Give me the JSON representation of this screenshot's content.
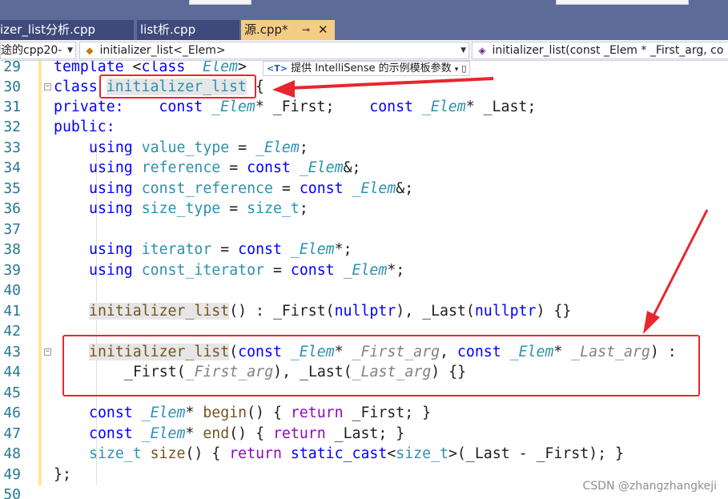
{
  "tabs": [
    {
      "label": "izer_list分析.cpp",
      "active": false
    },
    {
      "label": "list析.cpp",
      "active": false
    },
    {
      "label": "源.cpp*",
      "active": true,
      "pin": "⊸",
      "close": "✕"
    }
  ],
  "navbar": {
    "project": "途的cpp20-",
    "scope": "initializer_list<_Elem>",
    "member": "initializer_list(const _Elem * _First_arg, co"
  },
  "intellisense_hint": {
    "badge": "<T>",
    "text": "提供 IntelliSense 的示例模板参数"
  },
  "line_numbers": [
    "29",
    "30",
    "31",
    "32",
    "33",
    "34",
    "35",
    "36",
    "37",
    "38",
    "39",
    "40",
    "41",
    "42",
    "43",
    "44",
    "45",
    "46",
    "47",
    "48",
    "49",
    "50"
  ],
  "code": {
    "l29": {
      "kw": "template",
      "p1": " <",
      "kw2": "class",
      "sp": " ",
      "tp": "_Elem",
      "p2": ">"
    },
    "l30": {
      "kw": "class",
      "sp": " ",
      "name": "initializer_list",
      "p": " {"
    },
    "l31": {
      "kw": "private:",
      "sp1": "    ",
      "kw2": "const",
      "sp2": " ",
      "tp": "_Elem",
      "p1": "* _First;",
      "sp3": "    ",
      "kw3": "const",
      "sp4": " ",
      "tp2": "_Elem",
      "p2": "* _Last;"
    },
    "l32": {
      "kw": "public:"
    },
    "l33": {
      "kw": "using",
      "sp": " ",
      "ty": "value_type",
      "p1": " = ",
      "tp": "_Elem",
      "p2": ";"
    },
    "l34": {
      "kw": "using",
      "sp": " ",
      "ty": "reference",
      "p1": " = ",
      "kw2": "const",
      "sp2": " ",
      "tp": "_Elem",
      "p2": "&;"
    },
    "l35": {
      "kw": "using",
      "sp": " ",
      "ty": "const_reference",
      "p1": " = ",
      "kw2": "const",
      "sp2": " ",
      "tp": "_Elem",
      "p2": "&;"
    },
    "l36": {
      "kw": "using",
      "sp": " ",
      "ty": "size_type",
      "p1": " = ",
      "ty2": "size_t",
      "p2": ";"
    },
    "l38": {
      "kw": "using",
      "sp": " ",
      "ty": "iterator",
      "p1": " = ",
      "kw2": "const",
      "sp2": " ",
      "tp": "_Elem",
      "p2": "*;"
    },
    "l39": {
      "kw": "using",
      "sp": " ",
      "ty": "const_iterator",
      "p1": " = ",
      "kw2": "const",
      "sp2": " ",
      "tp": "_Elem",
      "p2": "*;"
    },
    "l41": {
      "fn": "initializer_list",
      "p1": "() : _First(",
      "kw": "nullptr",
      "p2": "), _Last(",
      "kw2": "nullptr",
      "p3": ") {}"
    },
    "l43": {
      "fn": "initializer_list",
      "p1": "(",
      "kw": "const",
      "sp": " ",
      "tp": "_Elem",
      "p2": "* ",
      "pr": "_First_arg",
      "p3": ", ",
      "kw2": "const",
      "sp2": " ",
      "tp2": "_Elem",
      "p4": "* ",
      "pr2": "_Last_arg",
      "p5": ") :"
    },
    "l44": {
      "p1": "_First(",
      "pr": "_First_arg",
      "p2": "), _Last(",
      "pr2": "_Last_arg",
      "p3": ") {}"
    },
    "l46": {
      "kw": "const",
      "sp": " ",
      "tp": "_Elem",
      "p1": "* ",
      "fn": "begin",
      "p2": "() { ",
      "ctl": "return",
      "p3": " _First; }"
    },
    "l47": {
      "kw": "const",
      "sp": " ",
      "tp": "_Elem",
      "p1": "* ",
      "fn": "end",
      "p2": "() { ",
      "ctl": "return",
      "p3": " _Last; }"
    },
    "l48": {
      "ty": "size_t",
      "sp": " ",
      "fn": "size",
      "p1": "() { ",
      "ctl": "return",
      "sp2": " ",
      "kw": "static_cast",
      "p2": "<",
      "ty2": "size_t",
      "p3": ">(_Last - _First); }"
    },
    "l49": {
      "p": "};"
    }
  },
  "watermark": "CSDN @zhangzhangkeji",
  "colors": {
    "keyword": "#0000ff",
    "type": "#2b91af",
    "function": "#74531f",
    "parameter": "#808080",
    "control": "#8f08c4",
    "annotation": "#e8262d",
    "line_number": "#237893",
    "active_tab": "#f5cc84"
  }
}
